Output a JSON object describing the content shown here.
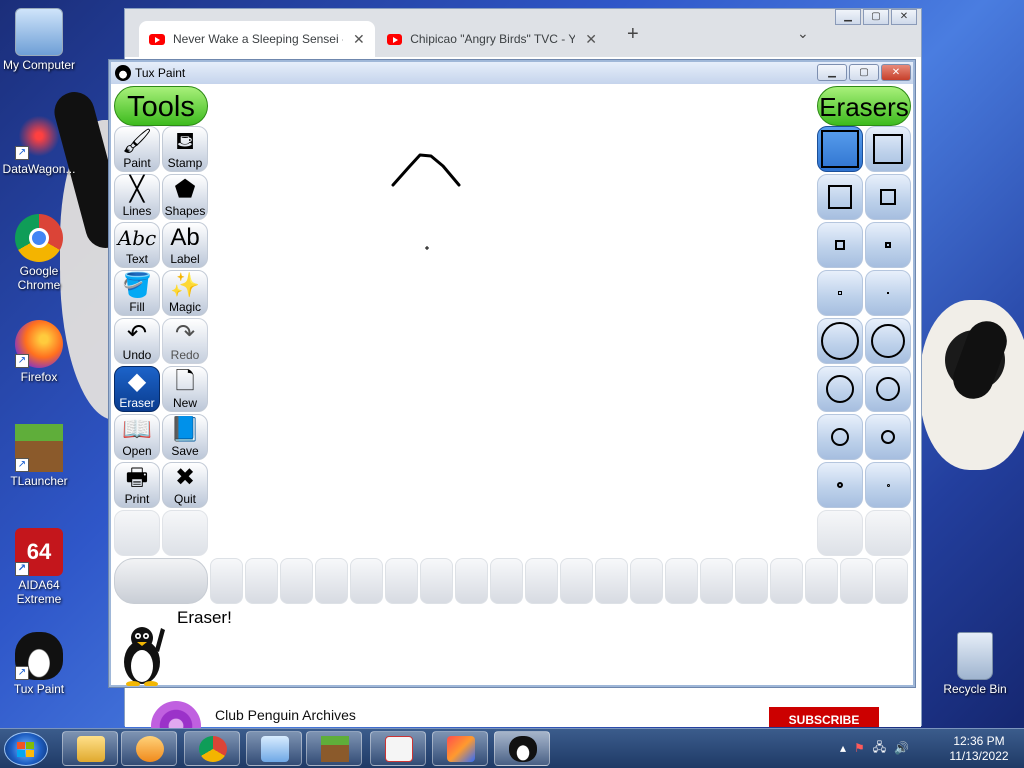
{
  "desktop": {
    "icons": [
      {
        "label": "My Computer"
      },
      {
        "label": "DataWagon..."
      },
      {
        "label": "Google Chrome"
      },
      {
        "label": "Firefox"
      },
      {
        "label": "TLauncher"
      },
      {
        "label": "AIDA64 Extreme"
      },
      {
        "label": "Tux Paint"
      },
      {
        "label": "Recycle Bin"
      }
    ]
  },
  "browser": {
    "tabs": [
      {
        "title": "Never Wake a Sleeping Sensei - ("
      },
      {
        "title": "Chipicao \"Angry Birds\" TVC - You"
      }
    ],
    "new_tab": "+",
    "channel_name": "Club Penguin Archives",
    "subscribe_label": "SUBSCRIBE"
  },
  "tuxpaint": {
    "window_title": "Tux Paint",
    "tools_header": "Tools",
    "erasers_header": "Erasers",
    "tools": [
      {
        "label": "Paint",
        "icon": "paintbrush-icon",
        "glyph": "🖌"
      },
      {
        "label": "Stamp",
        "icon": "stamp-icon",
        "glyph": "⛾"
      },
      {
        "label": "Lines",
        "icon": "lines-icon",
        "glyph": "╳"
      },
      {
        "label": "Shapes",
        "icon": "pentagon-icon",
        "glyph": "⬟"
      },
      {
        "label": "Text",
        "icon": "text-icon",
        "glyph": "Abc"
      },
      {
        "label": "Label",
        "icon": "label-icon",
        "glyph": "Ab"
      },
      {
        "label": "Fill",
        "icon": "bucket-icon",
        "glyph": "🪣"
      },
      {
        "label": "Magic",
        "icon": "magic-wand-icon",
        "glyph": "✨"
      },
      {
        "label": "Undo",
        "icon": "undo-icon",
        "glyph": "↶"
      },
      {
        "label": "Redo",
        "icon": "redo-icon",
        "glyph": "↷"
      },
      {
        "label": "Eraser",
        "icon": "eraser-icon",
        "glyph": "◆"
      },
      {
        "label": "New",
        "icon": "new-page-icon",
        "glyph": "🗋"
      },
      {
        "label": "Open",
        "icon": "open-book-icon",
        "glyph": "📖"
      },
      {
        "label": "Save",
        "icon": "save-book-icon",
        "glyph": "📘"
      },
      {
        "label": "Print",
        "icon": "printer-icon",
        "glyph": "🖶"
      },
      {
        "label": "Quit",
        "icon": "quit-icon",
        "glyph": "✖"
      }
    ],
    "selected_tool": "Eraser",
    "status_message": "Eraser!"
  },
  "taskbar": {
    "time": "12:36 PM",
    "date": "11/13/2022"
  },
  "colors": {
    "tools_header_bg": "#3dbb1e",
    "selected_tool": "#0a3c8f",
    "selected_eraser": "#2f73d0",
    "subscribe": "#cc0000"
  }
}
